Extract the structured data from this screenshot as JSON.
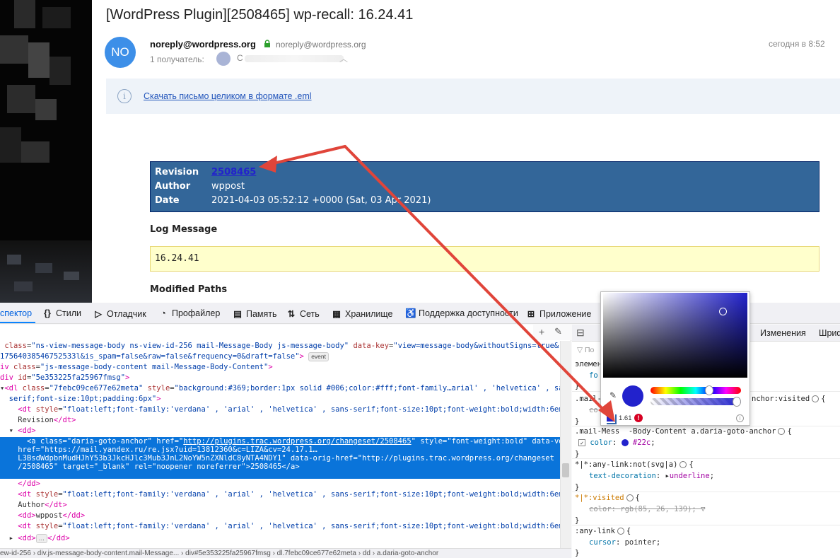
{
  "mail": {
    "title": "[WordPress Plugin][2508465] wp-recall: 16.24.41",
    "avatar_initials": "NO",
    "sender_name": "noreply@wordpress.org",
    "sender_email": "noreply@wordpress.org",
    "recipients_label": "1 получатель:",
    "recipient_initial": "С",
    "time": "сегодня в 8:52",
    "eml_link": "Скачать письмо целиком в формате .eml"
  },
  "revision": {
    "rows": [
      {
        "label": "Revision",
        "value": "2508465"
      },
      {
        "label": "Author",
        "value": "wppost"
      },
      {
        "label": "Date",
        "value": "2021-04-03 05:52:12 +0000 (Sat, 03 Apr 2021)"
      }
    ],
    "log_heading": "Log Message",
    "log_text": "16.24.41",
    "modified_heading": "Modified Paths"
  },
  "devtools": {
    "tabs": [
      {
        "icon": "",
        "label": "спектор"
      },
      {
        "icon": "{}",
        "label": "Стили"
      },
      {
        "icon": "▷",
        "label": "Отладчик"
      },
      {
        "icon": "◔",
        "label": "Профайлер"
      },
      {
        "icon": "▤",
        "label": "Память"
      },
      {
        "icon": "⇅",
        "label": "Сеть"
      },
      {
        "icon": "▦",
        "label": "Хранилище"
      },
      {
        "icon": "♿",
        "label": "Поддержка доступности"
      },
      {
        "icon": "⊞",
        "label": "Приложение"
      }
    ],
    "rules_tabs": [
      "Изменения",
      "Шриф"
    ],
    "filter_placeholder": "По",
    "event_badge": "event",
    "breadcrumb": "ew-id-256  ›  div.js-message-body-content.mail-Message...  ›  div#5e353225fa25967fmsg  ›  dl.7febc09ce677e62meta  ›  dd  ›  a.daria-goto-anchor"
  },
  "rules": {
    "element_label": "элемент",
    "rule1_partial_selector": ".mail-",
    "rule1_partial_prop": "co",
    "rule1_tail": "nchor:visited",
    "rule2_selector": ".mail-Mess  ‑Body-Content a.daria-goto-anchor",
    "rule2_prop": "color",
    "rule2_value": "#22c",
    "rule3_selector": "*|*:any-link:not(svg|a)",
    "rule3_prop": "text-decoration",
    "rule3_value": "underline",
    "rule4_selector": "*|*:visited",
    "rule4_prop": "color",
    "rule4_value": "rgb(85, 26, 139)",
    "rule5_selector": ":any-link",
    "rule5_prop": "cursor",
    "rule5_value": "pointer"
  },
  "color_picker": {
    "color": "#2222cc",
    "contrast_ratio": "1.61"
  },
  "colors": {
    "revision_bg": "#336699",
    "log_bg": "#ffffcc",
    "link": "#2222cc",
    "selection": "#0a74da",
    "annotation_arrow": "#e0453a"
  }
}
